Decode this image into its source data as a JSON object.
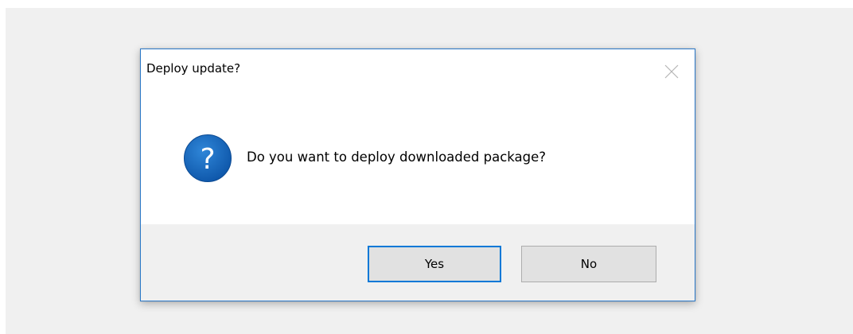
{
  "dialog": {
    "title": "Deploy update?",
    "message": "Do you want to deploy downloaded package?",
    "icon": "question-icon",
    "buttons": {
      "yes_label": "Yes",
      "no_label": "No"
    }
  },
  "colors": {
    "accent": "#0078d7",
    "icon_blue": "#1565c0",
    "footer_bg": "#f0f0f0"
  }
}
